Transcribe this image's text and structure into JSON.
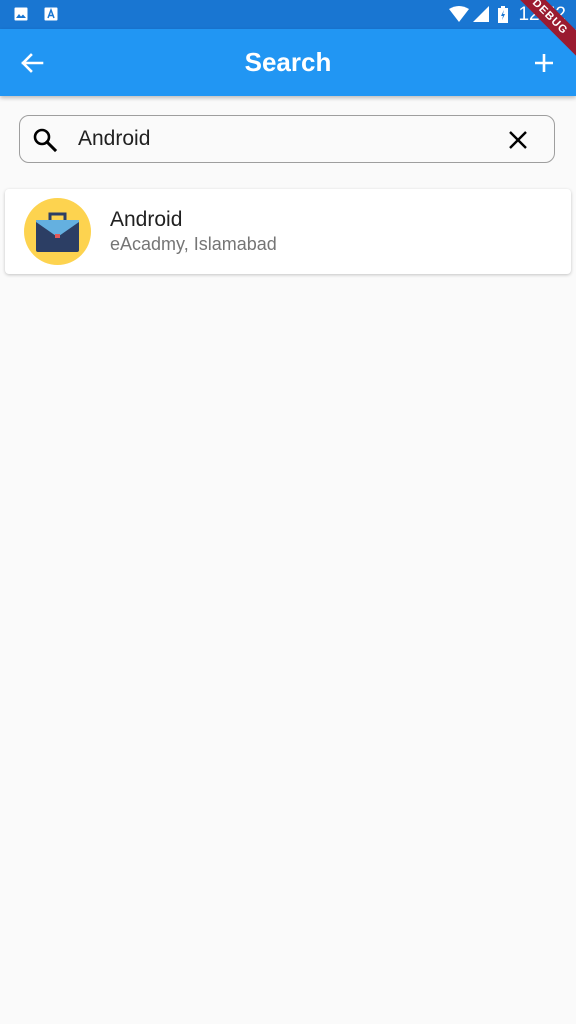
{
  "status_bar": {
    "time": "12:52",
    "left_icons": [
      "image-icon",
      "text-icon"
    ],
    "right_icons": [
      "wifi-icon",
      "signal-icon",
      "battery-icon"
    ]
  },
  "debug_banner": "DEBUG",
  "app_bar": {
    "title": "Search",
    "back_icon": "arrow-back-icon",
    "add_icon": "add-icon"
  },
  "search": {
    "value": "Android",
    "search_icon": "search-icon",
    "clear_icon": "close-icon"
  },
  "results": [
    {
      "title": "Android",
      "subtitle": "eAcadmy, Islamabad",
      "icon": "briefcase-icon",
      "avatar_color": "#fdd34f"
    }
  ],
  "colors": {
    "status_bar": "#1976d2",
    "app_bar": "#2196f3",
    "background": "#fafafa",
    "debug": "#9b1b30"
  }
}
